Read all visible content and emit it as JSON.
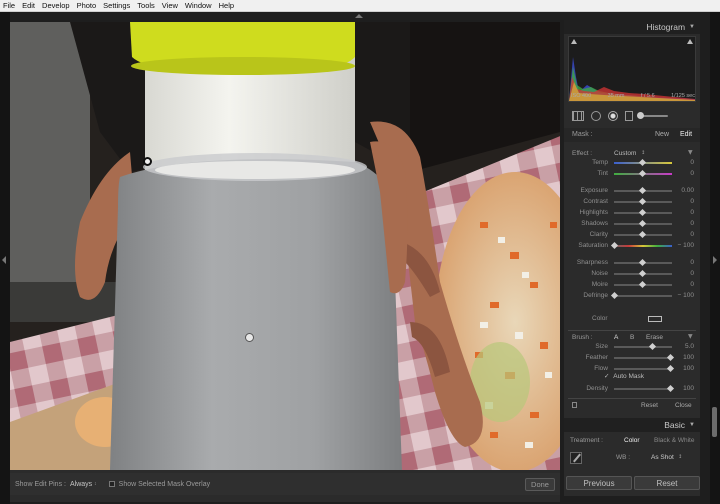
{
  "menu": [
    "File",
    "Edit",
    "Develop",
    "Photo",
    "Settings",
    "Tools",
    "View",
    "Window",
    "Help"
  ],
  "histogram": {
    "title": "Histogram",
    "iso": "ISO 400",
    "focal": "35 mm",
    "aperture": "f / 5.6",
    "shutter": "1/125 sec"
  },
  "mask": {
    "label": "Mask :",
    "new": "New",
    "edit": "Edit"
  },
  "effect": {
    "label": "Effect :",
    "preset": "Custom"
  },
  "sliders": [
    {
      "label": "Temp",
      "value": "0",
      "pos": 0.5
    },
    {
      "label": "Tint",
      "value": "0",
      "pos": 0.5
    },
    {
      "label": "Exposure",
      "value": "0.00",
      "pos": 0.5
    },
    {
      "label": "Contrast",
      "value": "0",
      "pos": 0.5
    },
    {
      "label": "Highlights",
      "value": "0",
      "pos": 0.5
    },
    {
      "label": "Shadows",
      "value": "0",
      "pos": 0.5
    },
    {
      "label": "Clarity",
      "value": "0",
      "pos": 0.5
    },
    {
      "label": "Saturation",
      "value": "− 100",
      "pos": 0.0
    },
    {
      "label": "Sharpness",
      "value": "0",
      "pos": 0.5
    },
    {
      "label": "Noise",
      "value": "0",
      "pos": 0.5
    },
    {
      "label": "Moire",
      "value": "0",
      "pos": 0.5
    },
    {
      "label": "Defringe",
      "value": "− 100",
      "pos": 0.0
    }
  ],
  "color_label": "Color",
  "brush": {
    "label": "Brush :",
    "a": "A",
    "b": "B",
    "erase": "Erase",
    "auto_mask": "Auto Mask",
    "rows": [
      {
        "label": "Size",
        "value": "5.0",
        "pos": 0.68
      },
      {
        "label": "Feather",
        "value": "100",
        "pos": 1.0
      },
      {
        "label": "Flow",
        "value": "100",
        "pos": 1.0
      },
      {
        "label": "Density",
        "value": "100",
        "pos": 1.0
      }
    ],
    "reset": "Reset",
    "close": "Close"
  },
  "basic": {
    "title": "Basic",
    "treatment_label": "Treatment :",
    "color": "Color",
    "bw": "Black & White",
    "wb_label": "WB :",
    "wb_value": "As Shot"
  },
  "buttons": {
    "previous": "Previous",
    "reset": "Reset",
    "done": "Done"
  },
  "bottom_bar": {
    "pins_label": "Show Edit Pins :",
    "pins_value": "Always",
    "overlay_label": "Show Selected Mask Overlay"
  },
  "colors": {
    "accent": "#d8e22a",
    "panel": "#2b2b2b",
    "overlay_gray": "#9a9c9e"
  }
}
